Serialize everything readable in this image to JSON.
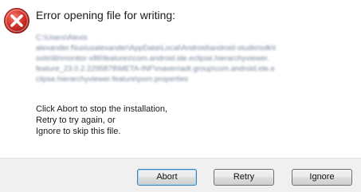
{
  "dialog": {
    "icon": "error-icon",
    "heading": "Error opening file for writing:",
    "path_lines": [
      "C:\\Users\\Alexis",
      "alexander.f\\iusiusalexander\\AppData\\Local\\Android\\android-studio\\sdk\\t",
      "ools\\lib\\monitor-x86\\features\\com.android.ide.eclipse.hierarchyviewer.",
      "feature_23.0.2.2295878\\META-INF\\maven\\adt.group\\com.android.ide.e",
      "clipse.hierarchyviewer.feature\\pom.properties"
    ],
    "instructions": [
      "Click Abort to stop the installation,",
      "Retry to try again, or",
      "Ignore to skip this file."
    ]
  },
  "buttons": {
    "abort": "Abort",
    "retry": "Retry",
    "ignore": "Ignore"
  },
  "colors": {
    "error_red": "#c42b1c",
    "footer_bg": "#f0f0f0",
    "focus_border": "#3c7fb1"
  }
}
